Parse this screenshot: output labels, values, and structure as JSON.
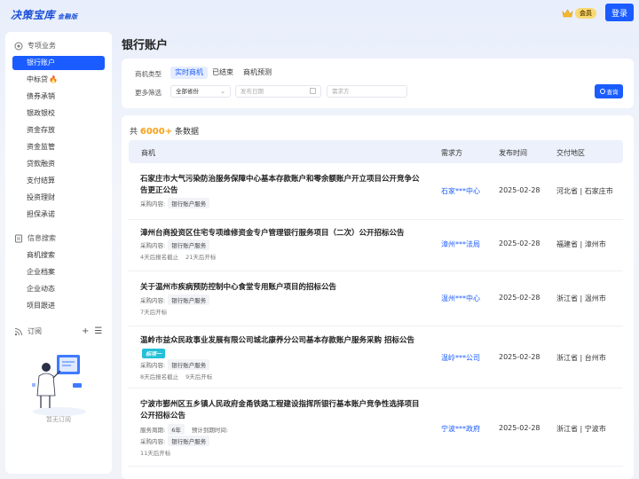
{
  "header": {
    "logo": "决策宝库",
    "edition": "金融版",
    "vip_label": "会员",
    "login": "登录"
  },
  "colors": {
    "accent": "#1a5cff",
    "count_highlight": "#f7a11a"
  },
  "sidebar": {
    "section1": "专项业务",
    "items1": [
      "银行账户",
      "中标贷",
      "债券承销",
      "银政银校",
      "资金存放",
      "资金监管",
      "贷款融资",
      "支付结算",
      "投资理财",
      "担保承诺"
    ],
    "fire": "🔥",
    "section2": "信息搜索",
    "items2": [
      "商机搜索",
      "企业档案",
      "企业动态",
      "项目跟进"
    ],
    "section3": "订阅",
    "add": "+",
    "menu": "☰",
    "empty": "暂无订阅"
  },
  "page": {
    "title": "银行账户"
  },
  "filters": {
    "type_label": "商机类型",
    "tabs": [
      "实时商机",
      "已结束",
      "商机预测"
    ],
    "more_label": "更多筛选",
    "province": "全部省份",
    "date_placeholder": "发布日期",
    "buyer_placeholder": "需求方",
    "search": "查询"
  },
  "list": {
    "count_prefix": "共",
    "count": "6000+",
    "count_suffix": "条数据",
    "headers": [
      "商机",
      "需求方",
      "发布时间",
      "交付地区"
    ],
    "rows": [
      {
        "title": "石家庄市大气污染防治服务保障中心基本存款账户和零余额账户开立项目公开竞争公告更正公告",
        "meta_label": "采购内容:",
        "chip": "银行账户服务",
        "buyer": "石家***中心",
        "date": "2025-02-28",
        "region": "河北省 | 石家庄市"
      },
      {
        "title": "漳州台商投资区住宅专项维修资金专户管理银行服务项目（二次）公开招标公告",
        "meta_label": "采购内容:",
        "chip": "银行账户服务",
        "notes": [
          "4天后报名截止",
          "21天后开标"
        ],
        "buyer": "漳州***法局",
        "date": "2025-02-28",
        "region": "福建省 | 漳州市"
      },
      {
        "title": "关于温州市疾病预防控制中心食堂专用账户项目的招标公告",
        "meta_label": "采购内容:",
        "chip": "银行账户服务",
        "notes": [
          "7天后开标"
        ],
        "buyer": "温州***中心",
        "date": "2025-02-28",
        "region": "浙江省 | 温州市"
      },
      {
        "title": "温岭市益众民政事业发展有限公司城北康养分公司基本存款账户服务采购 招标公告",
        "badge": "标项一",
        "meta_label": "采购内容:",
        "chip": "银行账户服务",
        "notes": [
          "8天后报名截止",
          "9天后开标"
        ],
        "buyer": "温岭***公司",
        "date": "2025-02-28",
        "region": "浙江省 | 台州市"
      },
      {
        "title": "宁波市鄞州区五乡镇人民政府金甬铁路工程建设指挥所银行基本账户竞争性选择项目公开招标公告",
        "period_label": "服务周期:",
        "period": "6年",
        "expire_label": "预计到期时间:",
        "meta_label": "采购内容:",
        "chip": "银行账户服务",
        "notes": [
          "11天后开标"
        ],
        "buyer": "宁波***政府",
        "date": "2025-02-28",
        "region": "浙江省 | 宁波市"
      }
    ]
  }
}
